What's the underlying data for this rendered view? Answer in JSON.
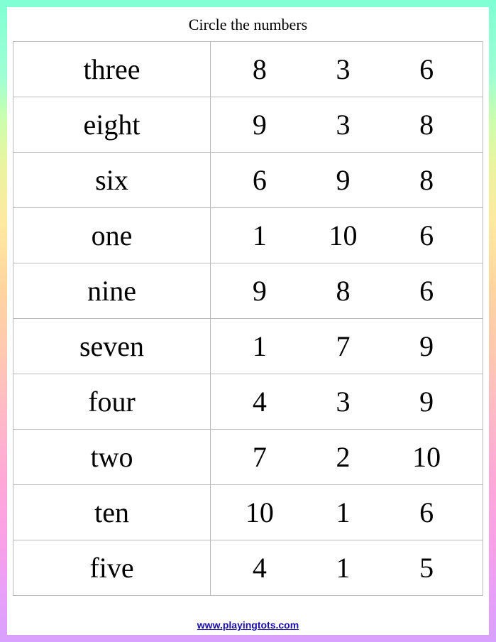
{
  "title": "Circle the numbers",
  "rows": [
    {
      "word": "three",
      "numbers": [
        "8",
        "3",
        "6"
      ]
    },
    {
      "word": "eight",
      "numbers": [
        "9",
        "3",
        "8"
      ]
    },
    {
      "word": "six",
      "numbers": [
        "6",
        "9",
        "8"
      ]
    },
    {
      "word": "one",
      "numbers": [
        "1",
        "10",
        "6"
      ]
    },
    {
      "word": "nine",
      "numbers": [
        "9",
        "8",
        "6"
      ]
    },
    {
      "word": "seven",
      "numbers": [
        "1",
        "7",
        "9"
      ]
    },
    {
      "word": "four",
      "numbers": [
        "4",
        "3",
        "9"
      ]
    },
    {
      "word": "two",
      "numbers": [
        "7",
        "2",
        "10"
      ]
    },
    {
      "word": "ten",
      "numbers": [
        "10",
        "1",
        "6"
      ]
    },
    {
      "word": "five",
      "numbers": [
        "4",
        "1",
        "5"
      ]
    }
  ],
  "footer": "www.playingtots.com"
}
